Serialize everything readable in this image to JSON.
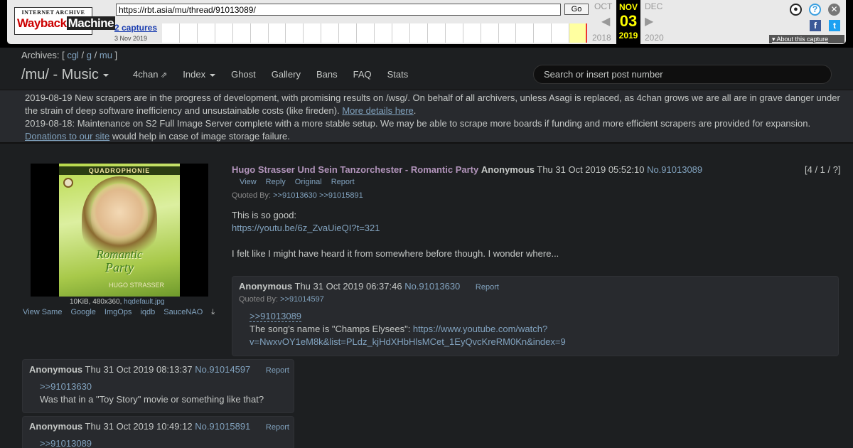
{
  "wayback": {
    "logo_top": "INTERNET ARCHIVE",
    "logo_wayback": "Wayback",
    "logo_machine": "Machine",
    "url": "https://rbt.asia/mu/thread/91013089/",
    "go_label": "Go",
    "captures": "2 captures",
    "capture_date": "3 Nov 2019",
    "prev_month": "OCT",
    "prev_year": "2018",
    "cur_month": "NOV",
    "cur_day": "03",
    "cur_year": "2019",
    "next_month": "DEC",
    "next_year": "2020",
    "about": "About this capture",
    "colors": {
      "bar": "#e9e9e9",
      "current": "#000000",
      "current_text": "#ffff00"
    }
  },
  "header": {
    "archives_label": "Archives: [",
    "archives_links": [
      "cgl",
      "g",
      "mu"
    ],
    "archives_close": "]",
    "board_title": "/mu/ - Music",
    "nav": [
      "4chan",
      "Index",
      "Ghost",
      "Gallery",
      "Bans",
      "FAQ",
      "Stats"
    ],
    "search_placeholder": "Search or insert post number"
  },
  "announcements": {
    "line1_text": "2019-08-19 New scrapers are in the progress of development, with promising results on /wsg/. On behalf of all archivers, unless Asagi is replaced, as 4chan grows we are all are in grave danger under the strain of deep software inefficiency and unsustainable costs (like fireden). ",
    "line1_link": "More details here",
    "line1_end": ".",
    "line2_text": "2019-08-18: Maintenance on S2 Full Image Server complete with a more stable setup. We may be able to scrape more boards if funding and more efficient scrapers are provided for expansion. ",
    "line2_link": "Donations to our site",
    "line2_end": " would help in case of image storage failure."
  },
  "op": {
    "thumb": {
      "band": "QUADROPHONIE",
      "title1": "Romantic",
      "title2": "Party",
      "artist": "HUGO STRASSER"
    },
    "file_info": "10KiB, 480x360,",
    "file_name": "hqdefault.jpg",
    "search_links": [
      "View Same",
      "Google",
      "ImgOps",
      "iqdb",
      "SauceNAO"
    ],
    "subject": "Hugo Strasser Und Sein Tanzorchester - Romantic Party",
    "name": "Anonymous",
    "date": "Thu 31 Oct 2019 05:52:10",
    "post_no": "No.91013089",
    "count": "[4 / 1 / ?]",
    "actions": [
      "View",
      "Reply",
      "Original",
      "Report"
    ],
    "quoted_by_label": "Quoted By:",
    "quoted_by": [
      ">>91013630",
      ">>91015891"
    ],
    "body_line1": "This is so good:",
    "body_link": "https://youtu.be/6z_ZvaUieQI?t=321",
    "body_line3": "I felt like I might have heard it from somewhere before though. I wonder where..."
  },
  "replies": [
    {
      "name": "Anonymous",
      "date": "Thu 31 Oct 2019 06:37:46",
      "post_no": "No.91013630",
      "report": "Report",
      "quoted_by_label": "Quoted By:",
      "quoted_by": ">>91014597",
      "quote": ">>91013089",
      "text": "The song's name is \"Champs Elysees\": ",
      "link1": "https://www.youtube.com/watch?",
      "link2": "v=NwxvOY1eM8k&list=PLdz_kjHdXHbHlsMCet_1EyQvcKreRM0Kn&index=9"
    },
    {
      "name": "Anonymous",
      "date": "Thu 31 Oct 2019 08:13:37",
      "post_no": "No.91014597",
      "report": "Report",
      "quote": ">>91013630",
      "text": "Was that in a \"Toy Story\" movie or something like that?"
    },
    {
      "name": "Anonymous",
      "date": "Thu 31 Oct 2019 10:49:12",
      "post_no": "No.91015891",
      "report": "Report",
      "quote": ">>91013089"
    }
  ],
  "colors": {
    "background": "#1d1f21",
    "text": "#c5c8c6",
    "link": "#81a2be",
    "subject": "#b294bb",
    "reply_bg": "#282a2e"
  }
}
